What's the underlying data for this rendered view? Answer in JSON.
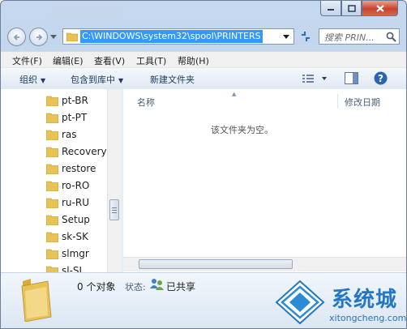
{
  "address": {
    "path": "C:\\WINDOWS\\system32\\spool\\PRINTERS"
  },
  "search": {
    "placeholder": "搜索 PRIN..."
  },
  "menu": [
    "文件(F)",
    "编辑(E)",
    "查看(V)",
    "工具(T)",
    "帮助(H)"
  ],
  "toolbar": {
    "organize": "组织",
    "include": "包含到库中",
    "new_folder": "新建文件夹"
  },
  "nav_items": [
    "pt-BR",
    "pt-PT",
    "ras",
    "Recovery",
    "restore",
    "ro-RO",
    "ru-RU",
    "Setup",
    "sk-SK",
    "slmgr",
    "sl-SI"
  ],
  "columns": {
    "name": "名称",
    "date": "修改日期"
  },
  "empty_message": "该文件夹为空。",
  "status": {
    "count": "0 个对象",
    "state_label": "状态:",
    "shared": "已共享"
  },
  "watermark": {
    "brand": "系统城",
    "url": "xitongcheng.com"
  },
  "colors": {
    "selection": "#3399ff",
    "folder": "#e8c255",
    "close": "#c7432d",
    "watermark": "#2477c5"
  }
}
